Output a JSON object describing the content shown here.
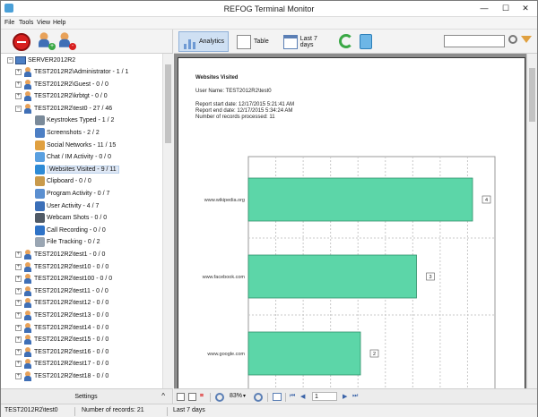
{
  "window": {
    "title": "REFOG Terminal Monitor",
    "minimize": "—",
    "maximize": "☐",
    "close": "✕"
  },
  "menu": [
    {
      "label": "File"
    },
    {
      "label": "Tools"
    },
    {
      "label": "View"
    },
    {
      "label": "Help"
    }
  ],
  "toolbar": {
    "analytics": "Analytics",
    "table": "Table",
    "period": "Last 7 days",
    "search_value": ""
  },
  "tree": {
    "root": "SERVER2012R2",
    "users_top": [
      {
        "label": "TEST2012R2\\Administrator - 1 / 1"
      },
      {
        "label": "TEST2012R2\\Guest - 0 / 0"
      },
      {
        "label": "TEST2012R2\\krbtgt - 0 / 0"
      },
      {
        "label": "TEST2012R2\\test0 - 27 / 46"
      }
    ],
    "categories": [
      {
        "label": "Keystrokes Typed - 1 / 2",
        "icon": "keyboard-icon",
        "color": "#7a8a9a"
      },
      {
        "label": "Screenshots - 2 / 2",
        "icon": "screenshot-icon",
        "color": "#4d7fc4"
      },
      {
        "label": "Social Networks - 11 / 15",
        "icon": "social-network-icon",
        "color": "#e0a040"
      },
      {
        "label": "Chat / IM Activity - 0 / 0",
        "icon": "chat-icon",
        "color": "#5aa0e0"
      },
      {
        "label": "Websites Visited - 9 / 11",
        "icon": "globe-icon",
        "color": "#2e8bd6"
      },
      {
        "label": "Clipboard - 0 / 0",
        "icon": "clipboard-icon",
        "color": "#c99a4b"
      },
      {
        "label": "Program Activity - 0 / 7",
        "icon": "program-icon",
        "color": "#5b8fd0"
      },
      {
        "label": "User Activity - 4 / 7",
        "icon": "user-activity-icon",
        "color": "#3b6fb8"
      },
      {
        "label": "Webcam Shots - 0 / 0",
        "icon": "webcam-icon",
        "color": "#505a66"
      },
      {
        "label": "Call Recording - 0 / 0",
        "icon": "phone-icon",
        "color": "#2f73c7"
      },
      {
        "label": "File Tracking - 0 / 2",
        "icon": "file-icon",
        "color": "#9aa6b3"
      }
    ],
    "users_bottom": [
      {
        "label": "TEST2012R2\\test1 - 0 / 0"
      },
      {
        "label": "TEST2012R2\\test10 - 0 / 0"
      },
      {
        "label": "TEST2012R2\\test100 - 0 / 0"
      },
      {
        "label": "TEST2012R2\\test11 - 0 / 0"
      },
      {
        "label": "TEST2012R2\\test12 - 0 / 0"
      },
      {
        "label": "TEST2012R2\\test13 - 0 / 0"
      },
      {
        "label": "TEST2012R2\\test14 - 0 / 0"
      },
      {
        "label": "TEST2012R2\\test15 - 0 / 0"
      },
      {
        "label": "TEST2012R2\\test16 - 0 / 0"
      },
      {
        "label": "TEST2012R2\\test17 - 0 / 0"
      },
      {
        "label": "TEST2012R2\\test18 - 0 / 0"
      }
    ]
  },
  "settings": {
    "label": "Settings",
    "chevron": "^"
  },
  "report": {
    "title": "Websites Visited",
    "user": "User Name: TEST2012R2\\test0",
    "start": "Report start date: 12/17/2015 5:21:41 AM",
    "end": "Report end date: 12/17/2015 5:34:24 AM",
    "records": "Number of records processed: 11"
  },
  "chart_data": {
    "type": "bar",
    "orientation": "horizontal",
    "categories": [
      "www.wikipedia.org",
      "www.facebook.com",
      "www.google.com"
    ],
    "values": [
      4,
      3,
      2
    ],
    "xlim": [
      0,
      4.4
    ],
    "grid": true,
    "bar_color": "#5cd6a8"
  },
  "viewer_footer": {
    "zoom": "83%",
    "page": "1"
  },
  "status": {
    "user": "TEST2012R2\\test0",
    "records": "Number of records: 21",
    "period": "Last 7 days"
  }
}
